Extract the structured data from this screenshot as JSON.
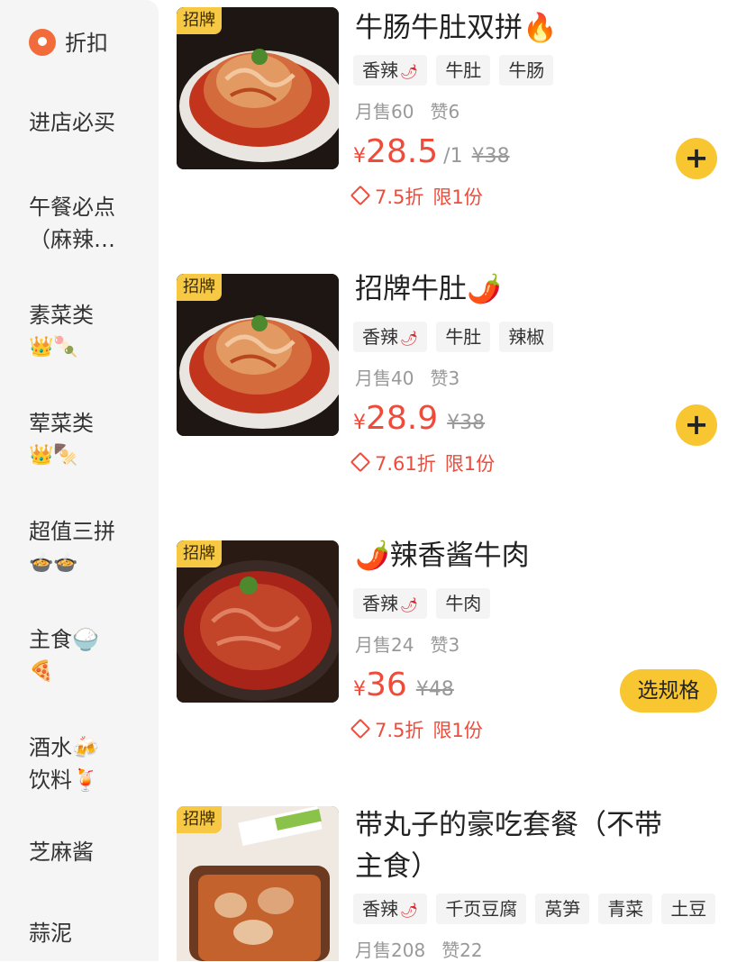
{
  "sidebar": {
    "items": [
      {
        "label": "折扣",
        "emoji": ""
      },
      {
        "label": "进店必买",
        "emoji": ""
      },
      {
        "label": "午餐必点（麻辣…",
        "emoji": ""
      },
      {
        "label": "素菜类",
        "emoji": "👑🍡"
      },
      {
        "label": "荤菜类",
        "emoji": "👑🍢"
      },
      {
        "label": "超值三拼",
        "emoji": "🍲🍲"
      },
      {
        "label": "主食🍚",
        "emoji": "🍕"
      },
      {
        "label": "酒水🍻",
        "emoji": "饮料🍹"
      },
      {
        "label": "芝麻酱",
        "emoji": ""
      },
      {
        "label": "蒜泥",
        "emoji": ""
      }
    ],
    "active_index": 0
  },
  "products": [
    {
      "badge": "招牌",
      "title": "牛肠牛肚双拼🔥",
      "tags": [
        "香辣",
        "牛肚",
        "牛肠"
      ],
      "monthly_sales": "月售60",
      "likes": "赞6",
      "currency": "¥",
      "price": "28.5",
      "unit": "/1",
      "original_price": "¥38",
      "discount": "7.5折",
      "limit": "限1份",
      "action": "+"
    },
    {
      "badge": "招牌",
      "title": "招牌牛肚🌶️",
      "tags": [
        "香辣",
        "牛肚",
        "辣椒"
      ],
      "monthly_sales": "月售40",
      "likes": "赞3",
      "currency": "¥",
      "price": "28.9",
      "unit": "",
      "original_price": "¥38",
      "discount": "7.61折",
      "limit": "限1份",
      "action": "+"
    },
    {
      "badge": "招牌",
      "title": "🌶️辣香酱牛肉",
      "tags": [
        "香辣",
        "牛肉"
      ],
      "monthly_sales": "月售24",
      "likes": "赞3",
      "currency": "¥",
      "price": "36",
      "unit": "",
      "original_price": "¥48",
      "discount": "7.5折",
      "limit": "限1份",
      "action": "选规格"
    },
    {
      "badge": "招牌",
      "title": "带丸子的豪吃套餐（不带主食）",
      "tags": [
        "香辣",
        "千页豆腐",
        "莴笋",
        "青菜",
        "土豆"
      ],
      "monthly_sales": "月售208",
      "likes": "赞22"
    }
  ],
  "spicy_tag_index": 0,
  "colors": {
    "accent": "#f7c631",
    "price": "#ef4b3b",
    "badge": "#f7c843",
    "sidebar_bg": "#f5f5f5"
  }
}
